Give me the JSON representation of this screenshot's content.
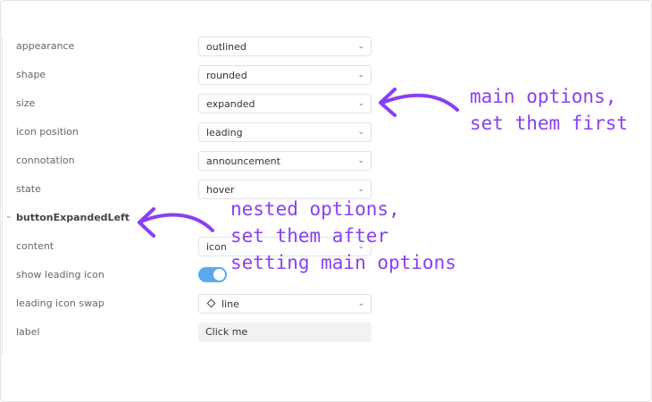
{
  "properties": [
    {
      "label": "appearance",
      "value": "outlined"
    },
    {
      "label": "shape",
      "value": "rounded"
    },
    {
      "label": "size",
      "value": "expanded"
    },
    {
      "label": "icon position",
      "value": "leading"
    },
    {
      "label": "connotation",
      "value": "announcement"
    },
    {
      "label": "state",
      "value": "hover"
    }
  ],
  "group": {
    "label": "buttonExpandedLeft",
    "content": {
      "label": "content",
      "value": "icon"
    },
    "show_leading_icon": {
      "label": "show leading icon",
      "on": true
    },
    "leading_icon_swap": {
      "label": "leading icon swap",
      "value": "line",
      "icon": "diamond-icon"
    },
    "text_label": {
      "label": "label",
      "value": "Click me"
    }
  },
  "annotations": {
    "main": [
      "main options,",
      "set them first"
    ],
    "nested": [
      "nested options,",
      "set them after",
      "setting main options"
    ]
  },
  "colors": {
    "annotation": "#8a3ff3",
    "toggle": "#5aa9ef"
  }
}
